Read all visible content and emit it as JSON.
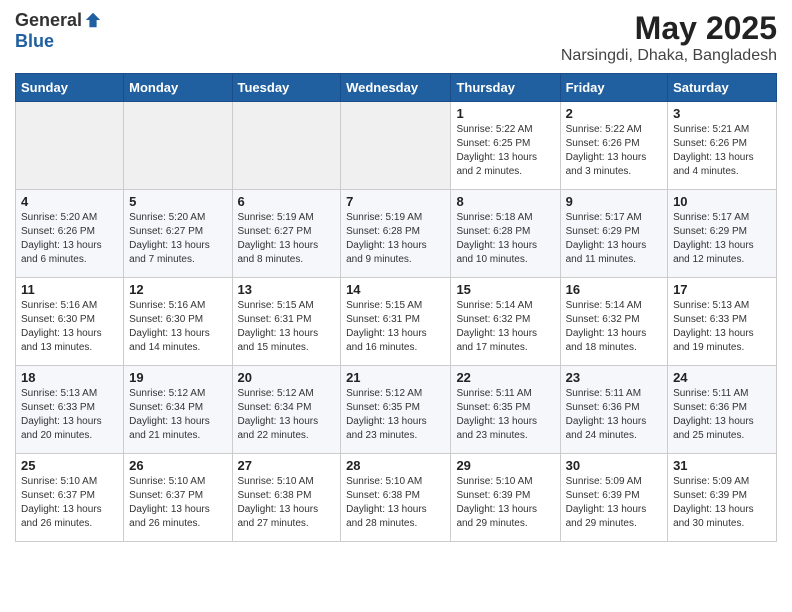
{
  "logo": {
    "general": "General",
    "blue": "Blue"
  },
  "title": "May 2025",
  "location": "Narsingdi, Dhaka, Bangladesh",
  "days_of_week": [
    "Sunday",
    "Monday",
    "Tuesday",
    "Wednesday",
    "Thursday",
    "Friday",
    "Saturday"
  ],
  "weeks": [
    {
      "cells": [
        {
          "day": null,
          "info": null
        },
        {
          "day": null,
          "info": null
        },
        {
          "day": null,
          "info": null
        },
        {
          "day": null,
          "info": null
        },
        {
          "day": "1",
          "info": "Sunrise: 5:22 AM\nSunset: 6:25 PM\nDaylight: 13 hours\nand 2 minutes."
        },
        {
          "day": "2",
          "info": "Sunrise: 5:22 AM\nSunset: 6:26 PM\nDaylight: 13 hours\nand 3 minutes."
        },
        {
          "day": "3",
          "info": "Sunrise: 5:21 AM\nSunset: 6:26 PM\nDaylight: 13 hours\nand 4 minutes."
        }
      ]
    },
    {
      "cells": [
        {
          "day": "4",
          "info": "Sunrise: 5:20 AM\nSunset: 6:26 PM\nDaylight: 13 hours\nand 6 minutes."
        },
        {
          "day": "5",
          "info": "Sunrise: 5:20 AM\nSunset: 6:27 PM\nDaylight: 13 hours\nand 7 minutes."
        },
        {
          "day": "6",
          "info": "Sunrise: 5:19 AM\nSunset: 6:27 PM\nDaylight: 13 hours\nand 8 minutes."
        },
        {
          "day": "7",
          "info": "Sunrise: 5:19 AM\nSunset: 6:28 PM\nDaylight: 13 hours\nand 9 minutes."
        },
        {
          "day": "8",
          "info": "Sunrise: 5:18 AM\nSunset: 6:28 PM\nDaylight: 13 hours\nand 10 minutes."
        },
        {
          "day": "9",
          "info": "Sunrise: 5:17 AM\nSunset: 6:29 PM\nDaylight: 13 hours\nand 11 minutes."
        },
        {
          "day": "10",
          "info": "Sunrise: 5:17 AM\nSunset: 6:29 PM\nDaylight: 13 hours\nand 12 minutes."
        }
      ]
    },
    {
      "cells": [
        {
          "day": "11",
          "info": "Sunrise: 5:16 AM\nSunset: 6:30 PM\nDaylight: 13 hours\nand 13 minutes."
        },
        {
          "day": "12",
          "info": "Sunrise: 5:16 AM\nSunset: 6:30 PM\nDaylight: 13 hours\nand 14 minutes."
        },
        {
          "day": "13",
          "info": "Sunrise: 5:15 AM\nSunset: 6:31 PM\nDaylight: 13 hours\nand 15 minutes."
        },
        {
          "day": "14",
          "info": "Sunrise: 5:15 AM\nSunset: 6:31 PM\nDaylight: 13 hours\nand 16 minutes."
        },
        {
          "day": "15",
          "info": "Sunrise: 5:14 AM\nSunset: 6:32 PM\nDaylight: 13 hours\nand 17 minutes."
        },
        {
          "day": "16",
          "info": "Sunrise: 5:14 AM\nSunset: 6:32 PM\nDaylight: 13 hours\nand 18 minutes."
        },
        {
          "day": "17",
          "info": "Sunrise: 5:13 AM\nSunset: 6:33 PM\nDaylight: 13 hours\nand 19 minutes."
        }
      ]
    },
    {
      "cells": [
        {
          "day": "18",
          "info": "Sunrise: 5:13 AM\nSunset: 6:33 PM\nDaylight: 13 hours\nand 20 minutes."
        },
        {
          "day": "19",
          "info": "Sunrise: 5:12 AM\nSunset: 6:34 PM\nDaylight: 13 hours\nand 21 minutes."
        },
        {
          "day": "20",
          "info": "Sunrise: 5:12 AM\nSunset: 6:34 PM\nDaylight: 13 hours\nand 22 minutes."
        },
        {
          "day": "21",
          "info": "Sunrise: 5:12 AM\nSunset: 6:35 PM\nDaylight: 13 hours\nand 23 minutes."
        },
        {
          "day": "22",
          "info": "Sunrise: 5:11 AM\nSunset: 6:35 PM\nDaylight: 13 hours\nand 23 minutes."
        },
        {
          "day": "23",
          "info": "Sunrise: 5:11 AM\nSunset: 6:36 PM\nDaylight: 13 hours\nand 24 minutes."
        },
        {
          "day": "24",
          "info": "Sunrise: 5:11 AM\nSunset: 6:36 PM\nDaylight: 13 hours\nand 25 minutes."
        }
      ]
    },
    {
      "cells": [
        {
          "day": "25",
          "info": "Sunrise: 5:10 AM\nSunset: 6:37 PM\nDaylight: 13 hours\nand 26 minutes."
        },
        {
          "day": "26",
          "info": "Sunrise: 5:10 AM\nSunset: 6:37 PM\nDaylight: 13 hours\nand 26 minutes."
        },
        {
          "day": "27",
          "info": "Sunrise: 5:10 AM\nSunset: 6:38 PM\nDaylight: 13 hours\nand 27 minutes."
        },
        {
          "day": "28",
          "info": "Sunrise: 5:10 AM\nSunset: 6:38 PM\nDaylight: 13 hours\nand 28 minutes."
        },
        {
          "day": "29",
          "info": "Sunrise: 5:10 AM\nSunset: 6:39 PM\nDaylight: 13 hours\nand 29 minutes."
        },
        {
          "day": "30",
          "info": "Sunrise: 5:09 AM\nSunset: 6:39 PM\nDaylight: 13 hours\nand 29 minutes."
        },
        {
          "day": "31",
          "info": "Sunrise: 5:09 AM\nSunset: 6:39 PM\nDaylight: 13 hours\nand 30 minutes."
        }
      ]
    }
  ]
}
